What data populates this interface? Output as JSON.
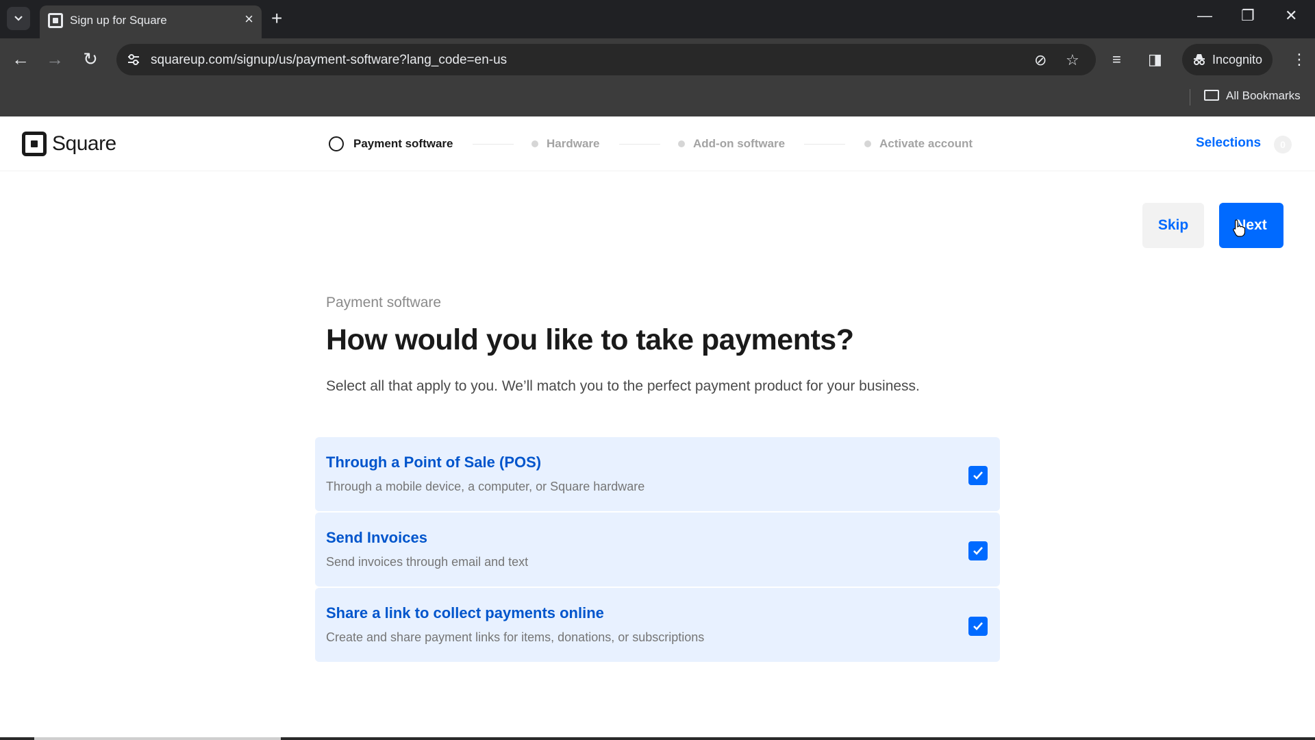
{
  "browser": {
    "tab_title": "Sign up for Square",
    "url": "squareup.com/signup/us/payment-software?lang_code=en-us",
    "incognito_label": "Incognito",
    "bookmarks_label": "All Bookmarks"
  },
  "header": {
    "logo_text": "Square",
    "steps": [
      {
        "label": "Payment software",
        "state": "active"
      },
      {
        "label": "Hardware",
        "state": "upcoming"
      },
      {
        "label": "Add-on software",
        "state": "upcoming"
      },
      {
        "label": "Activate account",
        "state": "upcoming"
      }
    ],
    "selections_label": "Selections",
    "selections_count": "0"
  },
  "actions": {
    "skip_label": "Skip",
    "next_label": "Next"
  },
  "main": {
    "eyebrow": "Payment software",
    "headline": "How would you like to take payments?",
    "subtext": "Select all that apply to you. We’ll match you to the perfect payment product for your business.",
    "options": [
      {
        "title": "Through a Point of Sale (POS)",
        "description": "Through a mobile device, a computer, or Square hardware",
        "checked": true
      },
      {
        "title": "Send Invoices",
        "description": "Send invoices through email and text",
        "checked": true
      },
      {
        "title": "Share a link to collect payments online",
        "description": "Create and share payment links for items, donations, or subscriptions",
        "checked": true
      }
    ]
  },
  "colors": {
    "accent": "#006aff",
    "option_bg": "#e8f1ff",
    "option_title": "#0055cc"
  }
}
